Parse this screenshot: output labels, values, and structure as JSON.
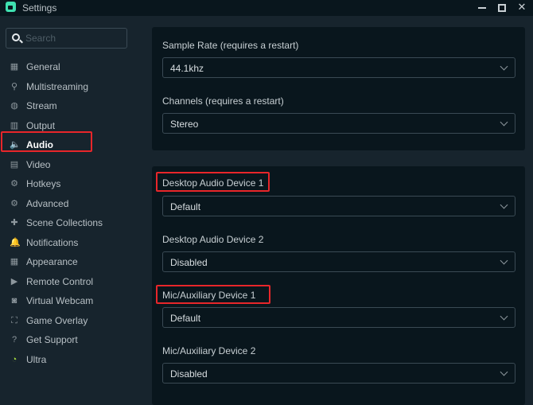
{
  "window": {
    "title": "Settings",
    "controls": {
      "minimize": "minimize",
      "maximize": "maximize",
      "close": "✕"
    }
  },
  "sidebar": {
    "search_placeholder": "Search",
    "items": [
      {
        "label": "General",
        "icon": "grid-icon"
      },
      {
        "label": "Multistreaming",
        "icon": "network-icon"
      },
      {
        "label": "Stream",
        "icon": "globe-icon"
      },
      {
        "label": "Output",
        "icon": "chip-icon"
      },
      {
        "label": "Audio",
        "icon": "speaker-icon",
        "active": true
      },
      {
        "label": "Video",
        "icon": "film-icon"
      },
      {
        "label": "Hotkeys",
        "icon": "gear-icon"
      },
      {
        "label": "Advanced",
        "icon": "gears-icon"
      },
      {
        "label": "Scene Collections",
        "icon": "puzzle-icon"
      },
      {
        "label": "Notifications",
        "icon": "bell-icon"
      },
      {
        "label": "Appearance",
        "icon": "palette-icon"
      },
      {
        "label": "Remote Control",
        "icon": "play-circle-icon"
      },
      {
        "label": "Virtual Webcam",
        "icon": "camera-icon"
      },
      {
        "label": "Game Overlay",
        "icon": "expand-icon"
      },
      {
        "label": "Get Support",
        "icon": "question-icon"
      },
      {
        "label": "Ultra",
        "icon": "ultra-icon"
      }
    ],
    "icon_glyphs": [
      "▦",
      "⚲",
      "◍",
      "▥",
      "🔈",
      "▤",
      "⚙",
      "⚙",
      "✚",
      "🔔",
      "▦",
      "▶",
      "◙",
      "⛶",
      "?",
      "◔"
    ]
  },
  "main": {
    "card1": {
      "sample_rate": {
        "label": "Sample Rate (requires a restart)",
        "value": "44.1khz"
      },
      "channels": {
        "label": "Channels (requires a restart)",
        "value": "Stereo"
      }
    },
    "card2": {
      "desktop1": {
        "label": "Desktop Audio Device 1",
        "value": "Default"
      },
      "desktop2": {
        "label": "Desktop Audio Device 2",
        "value": "Disabled"
      },
      "mic1": {
        "label": "Mic/Auxiliary Device 1",
        "value": "Default"
      },
      "mic2": {
        "label": "Mic/Auxiliary Device 2",
        "value": "Disabled"
      }
    }
  },
  "colors": {
    "accent": "#3fe0b0",
    "highlight": "#e8262a",
    "background": "#17242d",
    "card": "#09161d"
  }
}
